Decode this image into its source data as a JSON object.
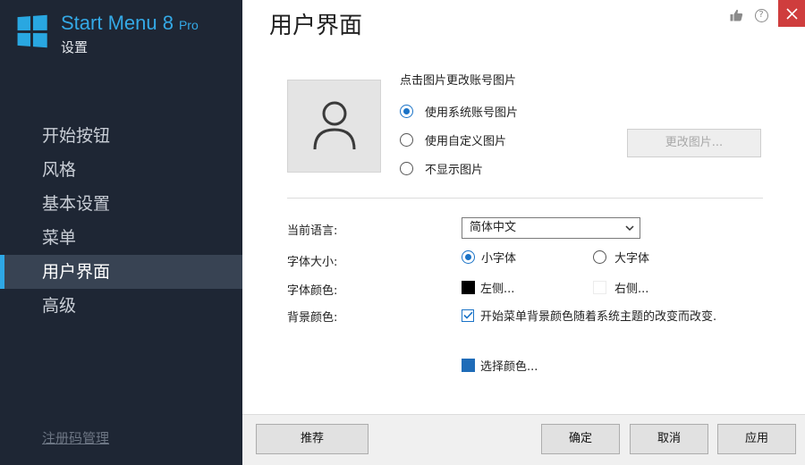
{
  "brand": {
    "title": "Start Menu 8",
    "edition": "Pro",
    "subtitle": "设置"
  },
  "sidebar": {
    "items": [
      {
        "label": "开始按钮",
        "active": false
      },
      {
        "label": "风格",
        "active": false
      },
      {
        "label": "基本设置",
        "active": false
      },
      {
        "label": "菜单",
        "active": false
      },
      {
        "label": "用户界面",
        "active": true
      },
      {
        "label": "高级",
        "active": false
      }
    ],
    "registration_link": "注册码管理"
  },
  "header": {
    "title": "用户界面"
  },
  "picture": {
    "hint": "点击图片更改账号图片",
    "options": [
      {
        "label": "使用系统账号图片",
        "selected": true
      },
      {
        "label": "使用自定义图片",
        "selected": false
      },
      {
        "label": "不显示图片",
        "selected": false
      }
    ],
    "change_button": "更改图片..."
  },
  "language": {
    "label": "当前语言:",
    "value": "简体中文"
  },
  "font_size": {
    "label": "字体大小:",
    "options": [
      {
        "label": "小字体",
        "selected": true
      },
      {
        "label": "大字体",
        "selected": false
      }
    ]
  },
  "font_color": {
    "label": "字体颜色:",
    "left": {
      "label": "左侧...",
      "color": "#000000"
    },
    "right": {
      "label": "右侧...",
      "color": "#ffffff"
    }
  },
  "background_color": {
    "label": "背景颜色:",
    "follow_theme_label": "开始菜单背景颜色随着系统主题的改变而改变.",
    "follow_theme_checked": true,
    "choose_label": "选择颜色...",
    "choose_color": "#1f6cb8"
  },
  "footer": {
    "recommend": "推荐",
    "ok": "确定",
    "cancel": "取消",
    "apply": "应用"
  },
  "colors": {
    "sidebar_bg": "#1e2634",
    "accent": "#2ea8e6",
    "close": "#cf3d3d"
  }
}
